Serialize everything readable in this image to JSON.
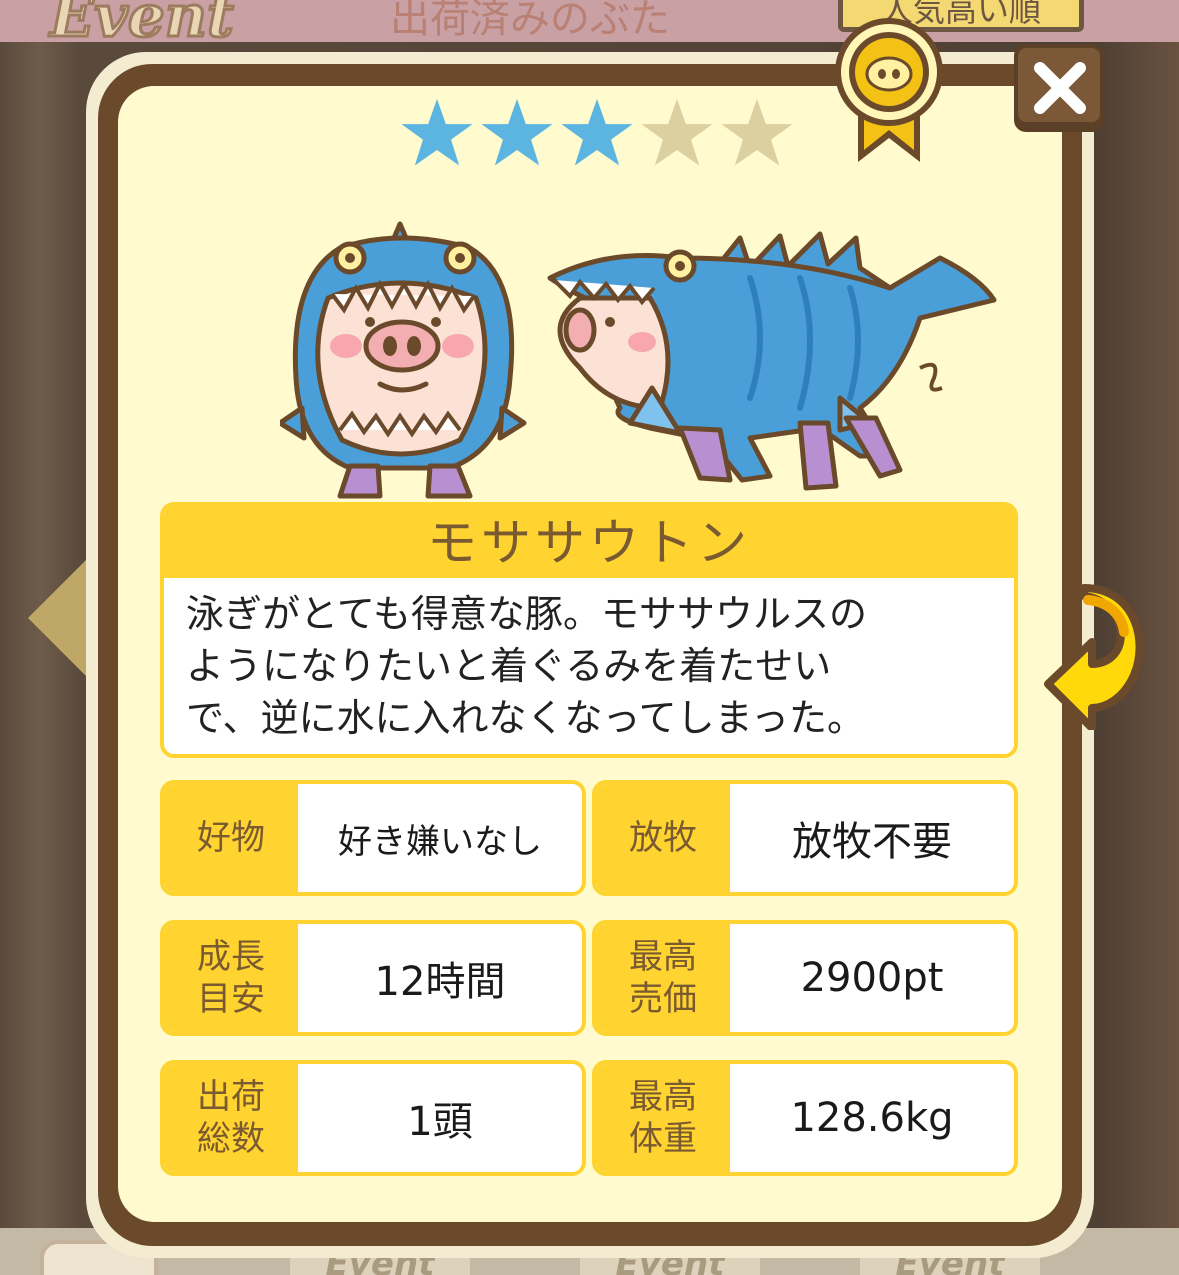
{
  "background": {
    "event_logo": "Event",
    "title": "出荷済みのぶた",
    "sort_button": "人気高い順",
    "bottom_tabs": [
      "Event",
      "Event",
      "Event"
    ]
  },
  "card": {
    "rating": 3,
    "rating_max": 5,
    "star_filled_color": "#5bb5e0",
    "star_empty_color": "#dccfa0",
    "name": "モササウトン",
    "description": [
      "泳ぎがとても得意な豚。モササウルスの",
      "ようになりたいと着ぐるみを着たせい",
      "で、逆に水に入れなくなってしまった。"
    ],
    "stats": [
      {
        "label": "好物",
        "value": "好き嫌いなし"
      },
      {
        "label": "放牧",
        "value": "放牧不要"
      },
      {
        "label": "成長目安",
        "label_lines": [
          "成長",
          "目安"
        ],
        "value": "12時間"
      },
      {
        "label": "最高売価",
        "label_lines": [
          "最高",
          "売価"
        ],
        "value": "2900pt"
      },
      {
        "label": "出荷総数",
        "label_lines": [
          "出荷",
          "総数"
        ],
        "value": "1頭"
      },
      {
        "label": "最高体重",
        "label_lines": [
          "最高",
          "体重"
        ],
        "value": "128.6kg"
      }
    ]
  },
  "icons": {
    "close": "close-icon",
    "medal": "pig-medal-icon",
    "next": "next-arrow-icon",
    "prev": "prev-arrow-icon"
  }
}
